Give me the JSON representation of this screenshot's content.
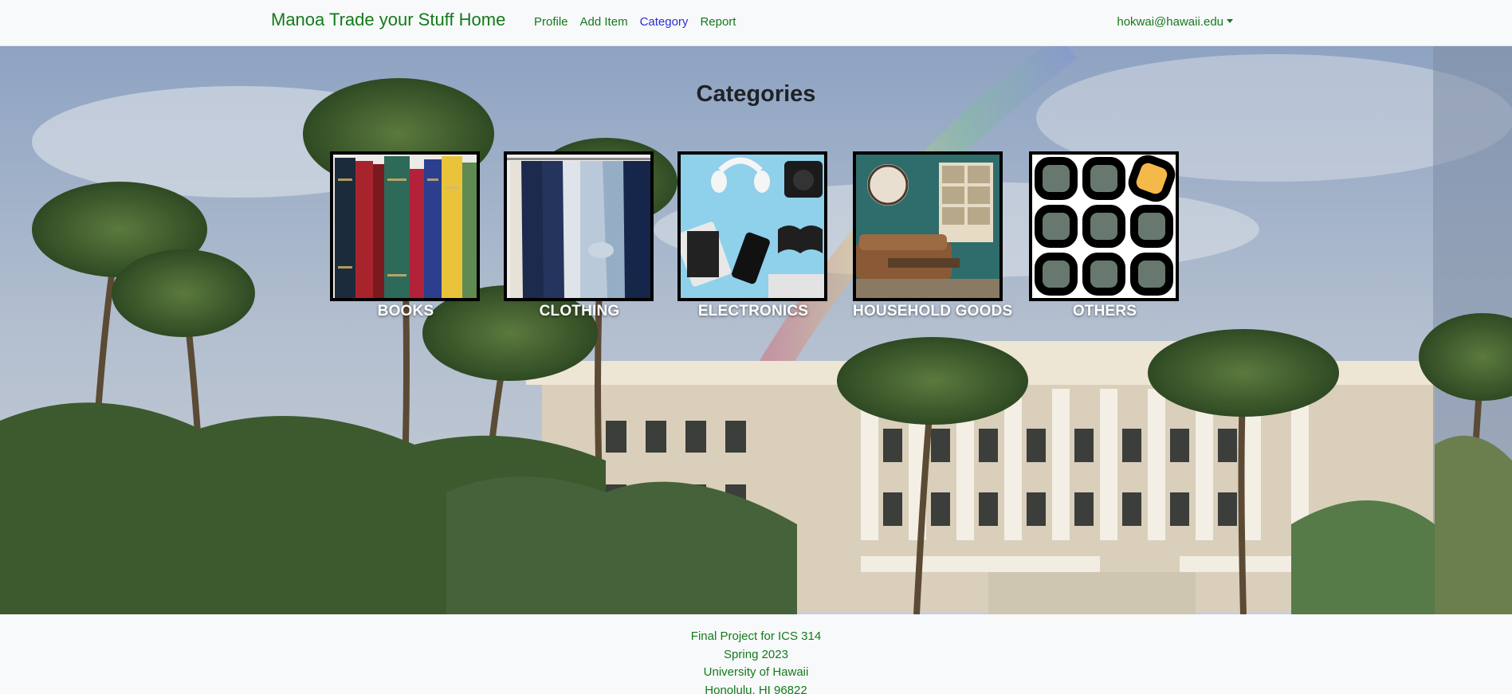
{
  "navbar": {
    "brand": "Manoa Trade your Stuff Home",
    "links": [
      {
        "label": "Profile",
        "active": false
      },
      {
        "label": "Add Item",
        "active": false
      },
      {
        "label": "Category",
        "active": true
      },
      {
        "label": "Report",
        "active": false
      }
    ],
    "user_email": "hokwai@hawaii.edu"
  },
  "main": {
    "title": "Categories",
    "categories": [
      {
        "label": "BOOKS",
        "image": "books-image"
      },
      {
        "label": "CLOTHING",
        "image": "clothing-image"
      },
      {
        "label": "ELECTRONICS",
        "image": "electronics-image"
      },
      {
        "label": "HOUSEHOLD GOODS",
        "image": "household-goods-image"
      },
      {
        "label": "OTHERS",
        "image": "others-grid-icon"
      }
    ]
  },
  "footer": {
    "lines": [
      "Final Project for ICS 314",
      "Spring 2023",
      "University of Hawaii",
      "Honolulu, HI 96822"
    ]
  },
  "colors": {
    "link_green": "#137a1b",
    "active_link": "#2a2ed1",
    "navbar_bg": "#f8f9fa",
    "others_accent": "#f5b94a",
    "others_tile": "#67786f"
  }
}
